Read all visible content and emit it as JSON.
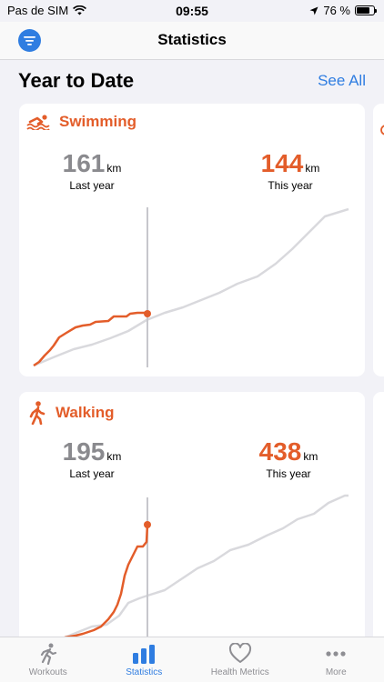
{
  "status_bar": {
    "carrier": "Pas de SIM",
    "time": "09:55",
    "battery": "76 %",
    "battery_level": 0.76
  },
  "nav": {
    "title": "Statistics"
  },
  "section": {
    "title": "Year to Date",
    "see_all": "See All"
  },
  "cards": [
    {
      "title": "Swimming",
      "icon": "swimmer-icon",
      "last_year": {
        "value": "161",
        "unit": "km",
        "label": "Last year"
      },
      "this_year": {
        "value": "144",
        "unit": "km",
        "label": "This year"
      }
    },
    {
      "title": "Walking",
      "icon": "walker-icon",
      "last_year": {
        "value": "195",
        "unit": "km",
        "label": "Last year"
      },
      "this_year": {
        "value": "438",
        "unit": "km",
        "label": "This year"
      }
    }
  ],
  "tabs": [
    {
      "label": "Workouts",
      "icon": "runner-icon",
      "active": false
    },
    {
      "label": "Statistics",
      "icon": "bar-chart-icon",
      "active": true
    },
    {
      "label": "Health Metrics",
      "icon": "heart-icon",
      "active": false
    },
    {
      "label": "More",
      "icon": "ellipsis-icon",
      "active": false
    }
  ],
  "colors": {
    "accent": "#2f7de1",
    "activity": "#e35d2a",
    "gray_line": "#d9d9dd"
  }
}
